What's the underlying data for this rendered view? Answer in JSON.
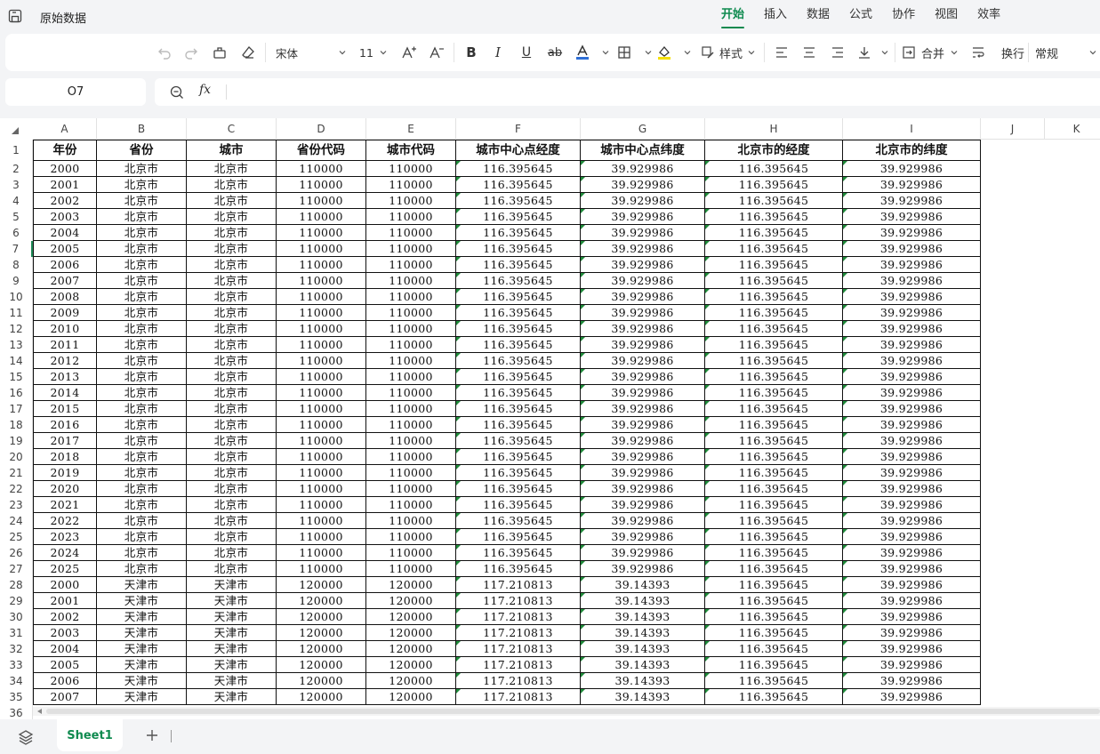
{
  "app": {
    "doc_title": "原始数据",
    "menu_tabs": [
      "开始",
      "插入",
      "数据",
      "公式",
      "协作",
      "视图",
      "效率"
    ]
  },
  "toolbar": {
    "font_name": "宋体",
    "font_size": "11",
    "style_label": "样式",
    "merge_label": "合并",
    "wrap_label": "换行",
    "format_label": "常规",
    "accent_color": "#0f8a4f",
    "font_color_bar": "#2f6fd6",
    "fill_color_bar": "#f5e000"
  },
  "formula": {
    "cell_ref": "O7",
    "fx": "fx",
    "value": ""
  },
  "grid": {
    "columns": [
      "A",
      "B",
      "C",
      "D",
      "E",
      "F",
      "G",
      "H",
      "I",
      "J",
      "K"
    ],
    "row_numbers": [
      "1",
      "2",
      "3",
      "4",
      "5",
      "6",
      "7",
      "8",
      "9",
      "10",
      "11",
      "12",
      "13",
      "14",
      "15",
      "16",
      "17",
      "18",
      "19",
      "20",
      "21",
      "22",
      "23",
      "24",
      "25",
      "26",
      "27",
      "28",
      "29",
      "30",
      "31",
      "32",
      "33",
      "34",
      "35",
      "36"
    ],
    "active_row": "7",
    "header": [
      "年份",
      "省份",
      "城市",
      "省份代码",
      "城市代码",
      "城市中心点经度",
      "城市中心点纬度",
      "北京市的经度",
      "北京市的纬度"
    ],
    "rows": [
      [
        "2000",
        "北京市",
        "北京市",
        "110000",
        "110000",
        "116.395645",
        "39.929986",
        "116.395645",
        "39.929986"
      ],
      [
        "2001",
        "北京市",
        "北京市",
        "110000",
        "110000",
        "116.395645",
        "39.929986",
        "116.395645",
        "39.929986"
      ],
      [
        "2002",
        "北京市",
        "北京市",
        "110000",
        "110000",
        "116.395645",
        "39.929986",
        "116.395645",
        "39.929986"
      ],
      [
        "2003",
        "北京市",
        "北京市",
        "110000",
        "110000",
        "116.395645",
        "39.929986",
        "116.395645",
        "39.929986"
      ],
      [
        "2004",
        "北京市",
        "北京市",
        "110000",
        "110000",
        "116.395645",
        "39.929986",
        "116.395645",
        "39.929986"
      ],
      [
        "2005",
        "北京市",
        "北京市",
        "110000",
        "110000",
        "116.395645",
        "39.929986",
        "116.395645",
        "39.929986"
      ],
      [
        "2006",
        "北京市",
        "北京市",
        "110000",
        "110000",
        "116.395645",
        "39.929986",
        "116.395645",
        "39.929986"
      ],
      [
        "2007",
        "北京市",
        "北京市",
        "110000",
        "110000",
        "116.395645",
        "39.929986",
        "116.395645",
        "39.929986"
      ],
      [
        "2008",
        "北京市",
        "北京市",
        "110000",
        "110000",
        "116.395645",
        "39.929986",
        "116.395645",
        "39.929986"
      ],
      [
        "2009",
        "北京市",
        "北京市",
        "110000",
        "110000",
        "116.395645",
        "39.929986",
        "116.395645",
        "39.929986"
      ],
      [
        "2010",
        "北京市",
        "北京市",
        "110000",
        "110000",
        "116.395645",
        "39.929986",
        "116.395645",
        "39.929986"
      ],
      [
        "2011",
        "北京市",
        "北京市",
        "110000",
        "110000",
        "116.395645",
        "39.929986",
        "116.395645",
        "39.929986"
      ],
      [
        "2012",
        "北京市",
        "北京市",
        "110000",
        "110000",
        "116.395645",
        "39.929986",
        "116.395645",
        "39.929986"
      ],
      [
        "2013",
        "北京市",
        "北京市",
        "110000",
        "110000",
        "116.395645",
        "39.929986",
        "116.395645",
        "39.929986"
      ],
      [
        "2014",
        "北京市",
        "北京市",
        "110000",
        "110000",
        "116.395645",
        "39.929986",
        "116.395645",
        "39.929986"
      ],
      [
        "2015",
        "北京市",
        "北京市",
        "110000",
        "110000",
        "116.395645",
        "39.929986",
        "116.395645",
        "39.929986"
      ],
      [
        "2016",
        "北京市",
        "北京市",
        "110000",
        "110000",
        "116.395645",
        "39.929986",
        "116.395645",
        "39.929986"
      ],
      [
        "2017",
        "北京市",
        "北京市",
        "110000",
        "110000",
        "116.395645",
        "39.929986",
        "116.395645",
        "39.929986"
      ],
      [
        "2018",
        "北京市",
        "北京市",
        "110000",
        "110000",
        "116.395645",
        "39.929986",
        "116.395645",
        "39.929986"
      ],
      [
        "2019",
        "北京市",
        "北京市",
        "110000",
        "110000",
        "116.395645",
        "39.929986",
        "116.395645",
        "39.929986"
      ],
      [
        "2020",
        "北京市",
        "北京市",
        "110000",
        "110000",
        "116.395645",
        "39.929986",
        "116.395645",
        "39.929986"
      ],
      [
        "2021",
        "北京市",
        "北京市",
        "110000",
        "110000",
        "116.395645",
        "39.929986",
        "116.395645",
        "39.929986"
      ],
      [
        "2022",
        "北京市",
        "北京市",
        "110000",
        "110000",
        "116.395645",
        "39.929986",
        "116.395645",
        "39.929986"
      ],
      [
        "2023",
        "北京市",
        "北京市",
        "110000",
        "110000",
        "116.395645",
        "39.929986",
        "116.395645",
        "39.929986"
      ],
      [
        "2024",
        "北京市",
        "北京市",
        "110000",
        "110000",
        "116.395645",
        "39.929986",
        "116.395645",
        "39.929986"
      ],
      [
        "2025",
        "北京市",
        "北京市",
        "110000",
        "110000",
        "116.395645",
        "39.929986",
        "116.395645",
        "39.929986"
      ],
      [
        "2000",
        "天津市",
        "天津市",
        "120000",
        "120000",
        "117.210813",
        "39.14393",
        "116.395645",
        "39.929986"
      ],
      [
        "2001",
        "天津市",
        "天津市",
        "120000",
        "120000",
        "117.210813",
        "39.14393",
        "116.395645",
        "39.929986"
      ],
      [
        "2002",
        "天津市",
        "天津市",
        "120000",
        "120000",
        "117.210813",
        "39.14393",
        "116.395645",
        "39.929986"
      ],
      [
        "2003",
        "天津市",
        "天津市",
        "120000",
        "120000",
        "117.210813",
        "39.14393",
        "116.395645",
        "39.929986"
      ],
      [
        "2004",
        "天津市",
        "天津市",
        "120000",
        "120000",
        "117.210813",
        "39.14393",
        "116.395645",
        "39.929986"
      ],
      [
        "2005",
        "天津市",
        "天津市",
        "120000",
        "120000",
        "117.210813",
        "39.14393",
        "116.395645",
        "39.929986"
      ],
      [
        "2006",
        "天津市",
        "天津市",
        "120000",
        "120000",
        "117.210813",
        "39.14393",
        "116.395645",
        "39.929986"
      ],
      [
        "2007",
        "天津市",
        "天津市",
        "120000",
        "120000",
        "117.210813",
        "39.14393",
        "116.395645",
        "39.929986"
      ]
    ],
    "text_number_columns": [
      5,
      6,
      7,
      8
    ]
  },
  "sheets": {
    "tabs": [
      "Sheet1"
    ],
    "active": "Sheet1"
  }
}
